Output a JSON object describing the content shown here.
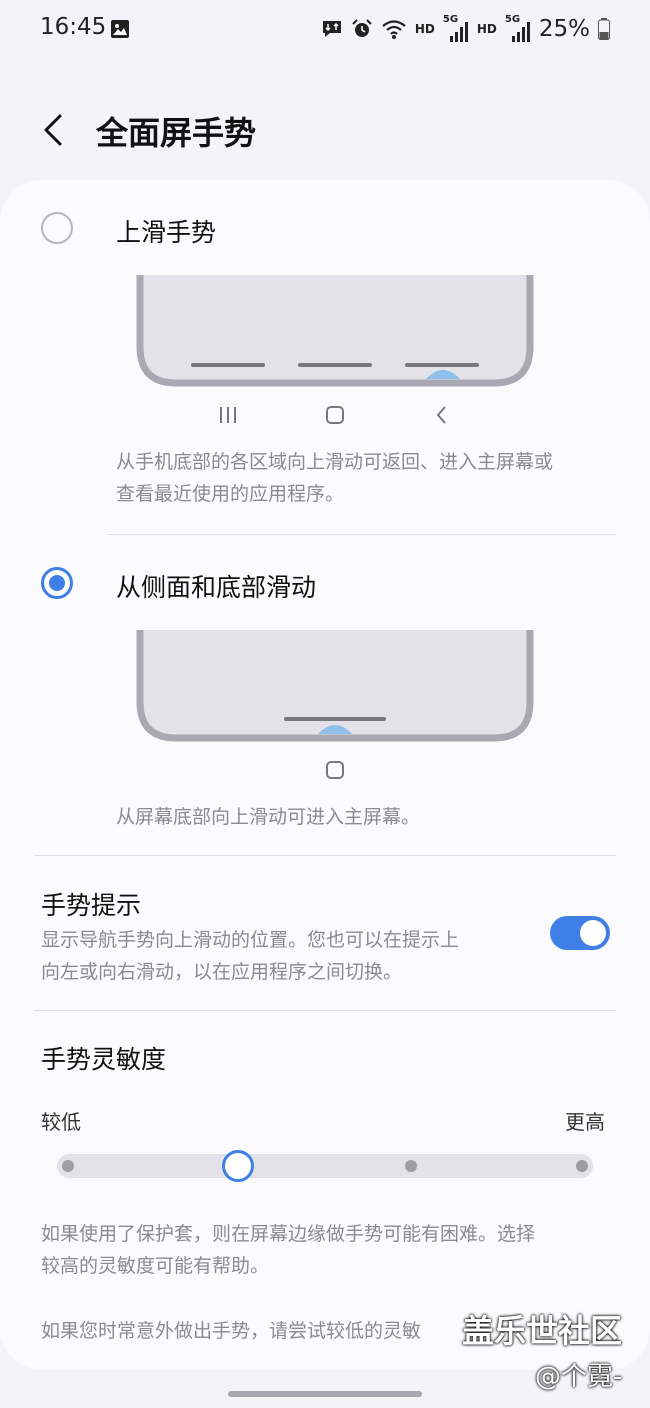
{
  "status_bar": {
    "time": "16:45",
    "hd1": "HD",
    "net1": "5G",
    "hd2": "HD",
    "net2": "5G",
    "battery": "25%"
  },
  "header": {
    "title": "全面屏手势"
  },
  "options": [
    {
      "label": "上滑手势",
      "selected": false,
      "description_line1": "从手机底部的各区域向上滑动可返回、进入主屏幕或",
      "description_line2": "查看最近使用的应用程序。"
    },
    {
      "label": "从侧面和底部滑动",
      "selected": true,
      "description_line1": "从屏幕底部向上滑动可进入主屏幕。"
    }
  ],
  "gesture_hint": {
    "title": "手势提示",
    "description_line1": "显示导航手势向上滑动的位置。您也可以在提示上",
    "description_line2": "向左或向右滑动，以在应用程序之间切换。",
    "enabled": true
  },
  "sensitivity": {
    "title": "手势灵敏度",
    "low_label": "较低",
    "high_label": "更高",
    "level": 2,
    "levels": 4,
    "note1_line1": "如果使用了保护套，则在屏幕边缘做手势可能有困难。选择",
    "note1_line2": "较高的灵敏度可能有帮助。",
    "note2": "如果您时常意外做出手势，请尝试较低的灵敏"
  },
  "watermark": {
    "main": "盖乐世社区",
    "sub": "@个霓-"
  },
  "colors": {
    "accent": "#3f7fe6",
    "background": "#f3f3f8",
    "card": "#fbfbfe"
  }
}
